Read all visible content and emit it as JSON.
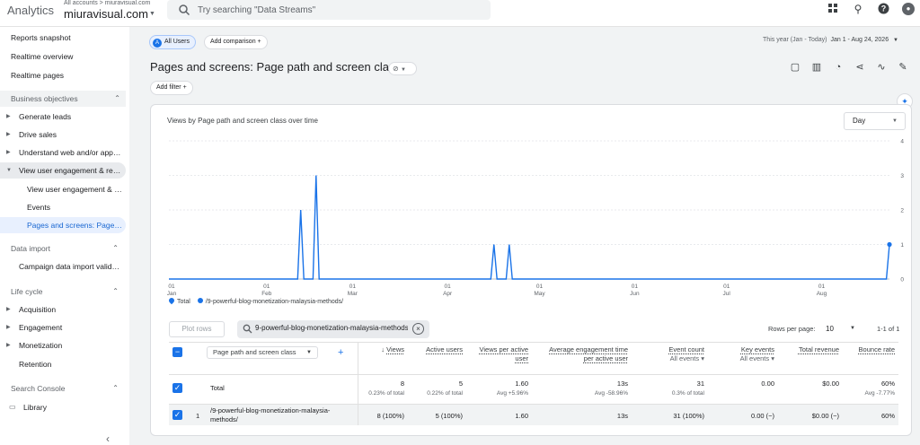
{
  "header": {
    "brand": "Analytics",
    "account_crumb": "All accounts > miuravisual.com",
    "account_name": "miuravisual.com",
    "search_placeholder": "Try searching \"Data Streams\""
  },
  "sidebar": {
    "top_items": [
      "Reports snapshot",
      "Realtime overview",
      "Realtime pages"
    ],
    "business_objectives": {
      "label": "Business objectives",
      "items": [
        "Generate leads",
        "Drive sales",
        "Understand web and/or app t...",
        "View user engagement & rete..."
      ],
      "sub_items": [
        "View user engagement & r...",
        "Events",
        "Pages and screens: Page p..."
      ]
    },
    "data_import": {
      "label": "Data import",
      "items": [
        "Campaign data import valida..."
      ]
    },
    "life_cycle": {
      "label": "Life cycle",
      "items": [
        "Acquisition",
        "Engagement",
        "Monetization",
        "Retention"
      ]
    },
    "search_console": {
      "label": "Search Console",
      "items": [
        "Library"
      ]
    }
  },
  "toolbar": {
    "segment_badge": "A",
    "segment_label": "All Users",
    "add_comparison": "Add comparison",
    "date_prefix": "This year (Jan - Today)",
    "date_range": "Jan 1 - Aug 24, 2026",
    "page_title": "Pages and screens: Page path and screen class",
    "add_filter": "Add filter"
  },
  "chart": {
    "title": "Views by Page path and screen class over time",
    "granularity": "Day",
    "legend_total": "Total",
    "legend_series": "/9-powerful-blog-monetization-malaysia-methods/"
  },
  "chart_data": {
    "type": "line",
    "x_ticks": [
      {
        "day": "01",
        "month": "Jan"
      },
      {
        "day": "01",
        "month": "Feb"
      },
      {
        "day": "01",
        "month": "Mar"
      },
      {
        "day": "01",
        "month": "Apr"
      },
      {
        "day": "01",
        "month": "May"
      },
      {
        "day": "01",
        "month": "Jun"
      },
      {
        "day": "01",
        "month": "Jul"
      },
      {
        "day": "01",
        "month": "Aug"
      }
    ],
    "y_ticks": [
      "0",
      "1",
      "2",
      "3",
      "4"
    ],
    "ylim": [
      0,
      4
    ],
    "series": [
      {
        "name": "/9-powerful-blog-monetization-malaysia-methods/",
        "color": "#1a73e8",
        "points": [
          {
            "date": "2026-01-01",
            "value": 0
          },
          {
            "date": "2026-02-12",
            "value": 0
          },
          {
            "date": "2026-02-13",
            "value": 2
          },
          {
            "date": "2026-02-14",
            "value": 0
          },
          {
            "date": "2026-02-17",
            "value": 0
          },
          {
            "date": "2026-02-18",
            "value": 3
          },
          {
            "date": "2026-02-19",
            "value": 0
          },
          {
            "date": "2026-04-16",
            "value": 0
          },
          {
            "date": "2026-04-17",
            "value": 1
          },
          {
            "date": "2026-04-18",
            "value": 0
          },
          {
            "date": "2026-04-21",
            "value": 0
          },
          {
            "date": "2026-04-22",
            "value": 1
          },
          {
            "date": "2026-04-23",
            "value": 0
          },
          {
            "date": "2026-08-23",
            "value": 0
          },
          {
            "date": "2026-08-24",
            "value": 1
          }
        ]
      }
    ]
  },
  "table": {
    "plot_rows": "Plot rows",
    "dimension_filter": "9-powerful-blog-monetization-malaysia-methods",
    "rows_per_page_label": "Rows per page:",
    "rows_per_page": "10",
    "pager": "1-1 of 1",
    "dimension_label": "Page path and screen class",
    "columns": [
      {
        "label": "Views",
        "sub": ""
      },
      {
        "label": "Active users",
        "sub": ""
      },
      {
        "label": "Views per active user",
        "sub": ""
      },
      {
        "label": "Average engagement time per active user",
        "sub": ""
      },
      {
        "label": "Event count",
        "sub": "All events"
      },
      {
        "label": "Key events",
        "sub": "All events"
      },
      {
        "label": "Total revenue",
        "sub": ""
      },
      {
        "label": "Bounce rate",
        "sub": ""
      }
    ],
    "total_label": "Total",
    "totals": [
      {
        "value": "8",
        "sub": "0.23% of total"
      },
      {
        "value": "5",
        "sub": "0.22% of total"
      },
      {
        "value": "1.60",
        "sub": "Avg +5.96%"
      },
      {
        "value": "13s",
        "sub": "Avg -58.96%"
      },
      {
        "value": "31",
        "sub": "0.3% of total"
      },
      {
        "value": "0.00",
        "sub": ""
      },
      {
        "value": "$0.00",
        "sub": ""
      },
      {
        "value": "60%",
        "sub": "Avg -7.77%"
      }
    ],
    "rows": [
      {
        "num": "1",
        "path": "/9-powerful-blog-monetization-malaysia-methods/",
        "values": [
          "8 (100%)",
          "5 (100%)",
          "1.60",
          "13s",
          "31 (100%)",
          "0.00 (−)",
          "$0.00 (−)",
          "60%"
        ]
      }
    ]
  }
}
